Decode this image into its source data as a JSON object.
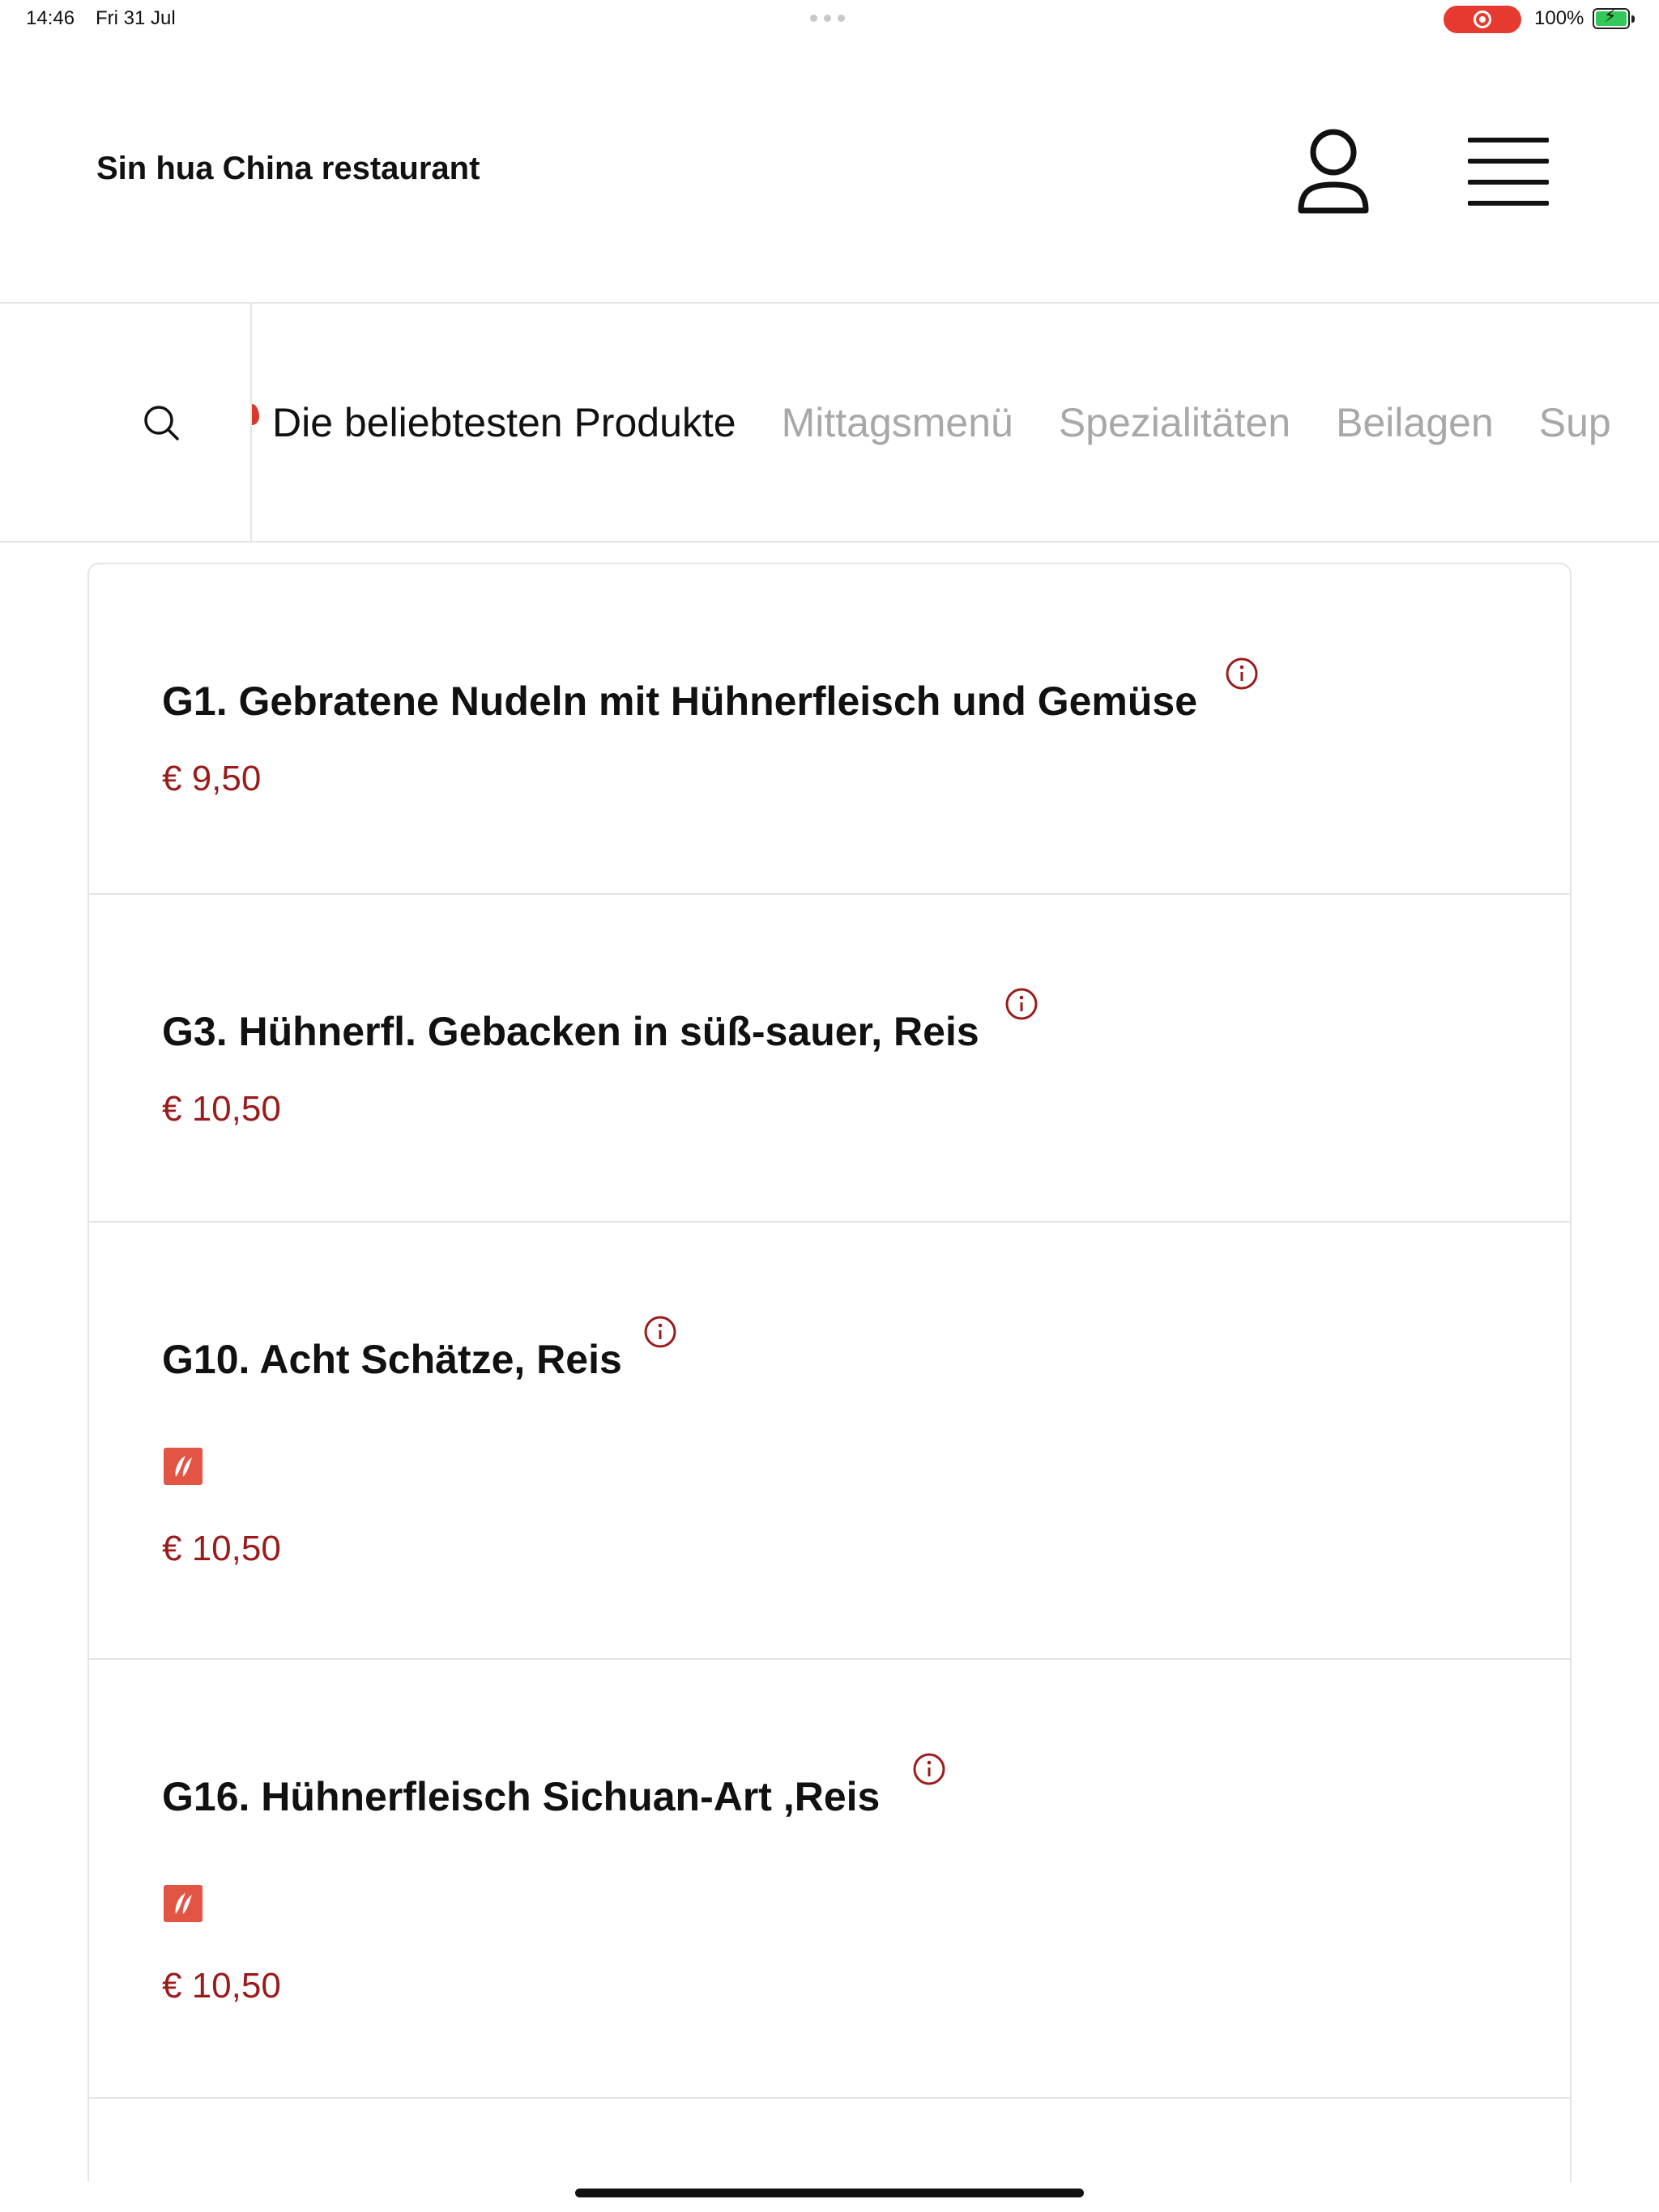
{
  "status_bar": {
    "time": "14:46",
    "date": "Fri 31 Jul",
    "battery_percent": "100%",
    "battery_level": 1.0,
    "recording_color": "#e63a30"
  },
  "header": {
    "title": "Sin hua China restaurant",
    "user_icon": "user-icon",
    "menu_icon": "hamburger-menu-icon"
  },
  "categories": {
    "search_icon": "search-icon",
    "tabs": [
      {
        "label": "Die beliebtesten Produkte",
        "active": true
      },
      {
        "label": "Mittagsmenü",
        "active": false
      },
      {
        "label": "Spezialitäten",
        "active": false
      },
      {
        "label": "Beilagen",
        "active": false
      },
      {
        "label": "Sup",
        "active": false
      }
    ]
  },
  "products": [
    {
      "name": "G1. Gebratene Nudeln mit Hühnerfleisch und Gemüse",
      "price": "€ 9,50",
      "spicy": false
    },
    {
      "name": "G3. Hühnerfl. Gebacken in süß-sauer, Reis",
      "price": "€ 10,50",
      "spicy": false
    },
    {
      "name": "G10. Acht Schätze, Reis",
      "price": "€ 10,50",
      "spicy": true
    },
    {
      "name": "G16. Hühnerfleisch Sichuan-Art ,Reis",
      "price": "€ 10,50",
      "spicy": true
    }
  ],
  "colors": {
    "accent_price": "#9b1b1b",
    "spicy_badge": "#e25545",
    "active_tab": "#111111",
    "inactive_tab": "#a8a8a8"
  }
}
